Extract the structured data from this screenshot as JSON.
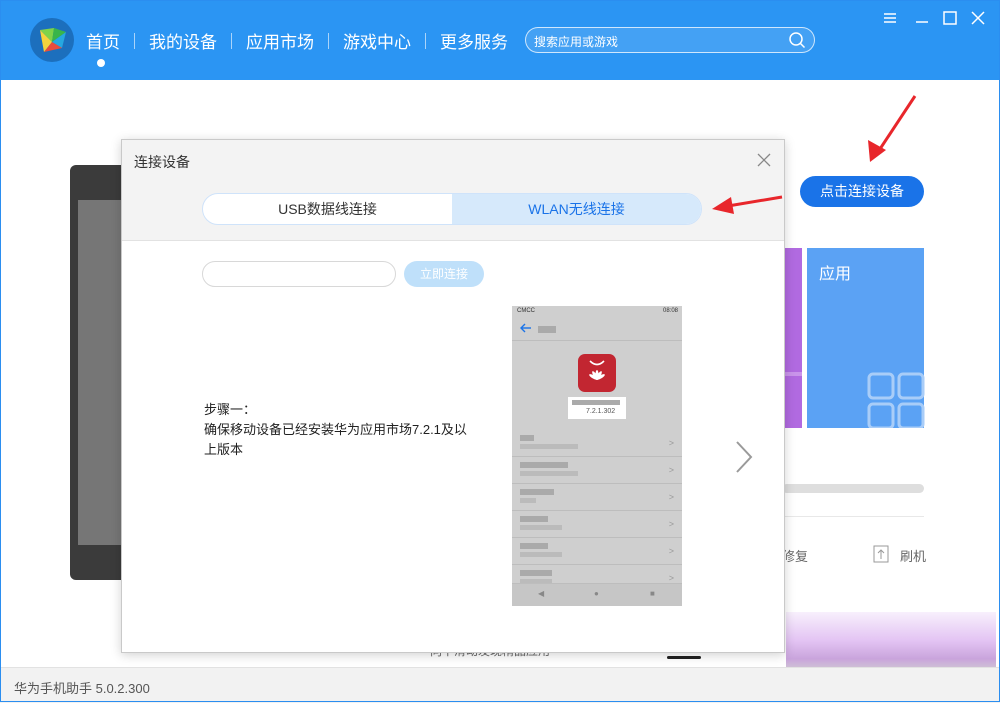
{
  "nav": {
    "items": [
      "首页",
      "我的设备",
      "应用市场",
      "游戏中心",
      "更多服务"
    ],
    "active_index": 0
  },
  "search": {
    "placeholder": "搜索应用或游戏"
  },
  "window_controls": [
    "minimize-icon",
    "restore-icon",
    "maximize-icon",
    "close-icon"
  ],
  "main": {
    "connect_button": "点击连接设备",
    "tile_label": "应用",
    "repair_label": "修复",
    "flash_label": "刷机",
    "bottom_hint": "向下滑动发现精品应用"
  },
  "dialog": {
    "title": "连接设备",
    "tabs": [
      {
        "label": "USB数据线连接",
        "selected": false
      },
      {
        "label": "WLAN无线连接",
        "selected": true
      }
    ],
    "ip_input": {
      "value": "",
      "placeholder": ""
    },
    "connect_now": "立即连接",
    "step_title": "步骤一：",
    "step_desc": "确保移动设备已经安装华为应用市场7.2.1及以上版本",
    "phone": {
      "carrier": "CMCC",
      "time": "08:08",
      "version": "7.2.1.302"
    }
  },
  "status_bar": {
    "text": "华为手机助手 5.0.2.300"
  },
  "colors": {
    "topbar": "#2b95f3",
    "accent": "#1a73e8",
    "annotation_arrow": "#e8262b"
  }
}
